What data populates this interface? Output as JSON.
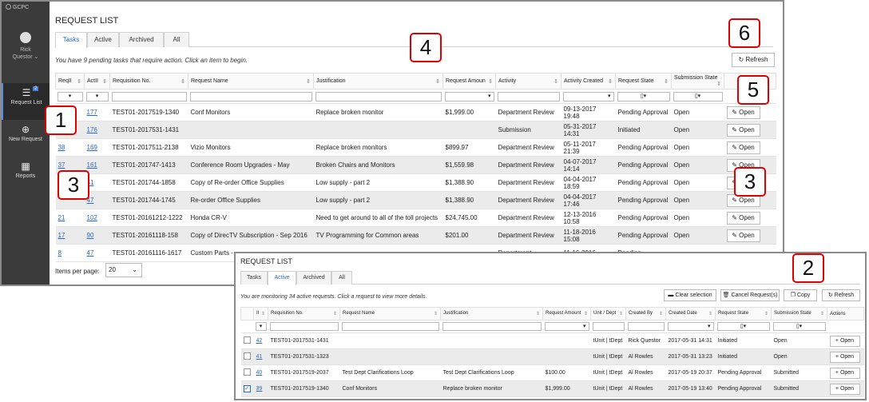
{
  "app": {
    "brand": "GCPC",
    "user_name": "Rick",
    "user_last": "Questor ⌄",
    "nav": [
      {
        "label": "Request List",
        "icon": "list-icon",
        "badge": "2"
      },
      {
        "label": "New Request",
        "icon": "plus-circle-icon"
      },
      {
        "label": "Reports",
        "icon": "grid-icon"
      }
    ]
  },
  "list1": {
    "title": "REQUEST LIST",
    "tabs": [
      "Tasks",
      "Active",
      "Archived",
      "All"
    ],
    "active_tab": "Tasks",
    "message": "You have 9 pending tasks that require action. Click an item to begin.",
    "refresh_label": "Refresh",
    "columns": [
      "ReqII",
      "ActII",
      "Requisition No.",
      "Request Name",
      "Justification",
      "Request Amoun",
      "Activity",
      "Activity Created",
      "Request State",
      "Submission State"
    ],
    "filter_glyph": "▾",
    "state_filter_glyph": "▯▾",
    "open_label": "Open",
    "rows": [
      {
        "req": "",
        "act": "177",
        "reqno": "TEST01-2017519-1340",
        "name": "Conf Monitors",
        "just": "Replace broken monitor",
        "amount": "$1,999.00",
        "activity": "Department Review",
        "created": "09-13-2017 19:48",
        "state": "Pending Approval",
        "sub": "Open"
      },
      {
        "req": "",
        "act": "176",
        "reqno": "TEST01-2017531-1431",
        "name": "",
        "just": "",
        "amount": "",
        "activity": "Submission",
        "created": "05-31-2017 14:31",
        "state": "Initiated",
        "sub": "Open"
      },
      {
        "req": "38",
        "act": "169",
        "reqno": "TEST01-2017511-2138",
        "name": "Vizio Monitors",
        "just": "Replace broken monitors",
        "amount": "$899.97",
        "activity": "Department Review",
        "created": "05-11-2017 21:39",
        "state": "Pending Approval",
        "sub": "Open"
      },
      {
        "req": "37",
        "act": "161",
        "reqno": "TEST01-201747-1413",
        "name": "Conference Room Upgrades - May",
        "just": "Broken Chairs and Monitors",
        "amount": "$1,559.98",
        "activity": "Department Review",
        "created": "04-07-2017 14:14",
        "state": "Pending Approval",
        "sub": "Open"
      },
      {
        "req": "",
        "act": "51",
        "reqno": "TEST01-201744-1858",
        "name": "Copy of Re-order Office Supplies",
        "just": "Low supply - part 2",
        "amount": "$1,388.90",
        "activity": "Department Review",
        "created": "04-04-2017 18:59",
        "state": "Pending Approval",
        "sub": "Open"
      },
      {
        "req": "",
        "act": "47",
        "reqno": "TEST01-201744-1745",
        "name": "Re-order Office Supplies",
        "just": "Low supply - part 2",
        "amount": "$1,388.90",
        "activity": "Department Review",
        "created": "04-04-2017 17:46",
        "state": "Pending Approval",
        "sub": "Open"
      },
      {
        "req": "21",
        "act": "102",
        "reqno": "TEST01-20161212-1222",
        "name": "Honda CR-V",
        "just": "Need to get around to all of the toll projects",
        "amount": "$24,745.00",
        "activity": "Department Review",
        "created": "12-13-2016 10:58",
        "state": "Pending Approval",
        "sub": "Open"
      },
      {
        "req": "17",
        "act": "90",
        "reqno": "TEST01-20161118-158",
        "name": "Copy of DirecTV Subscription - Sep 2016",
        "just": "TV Programming for Common areas",
        "amount": "$201.00",
        "activity": "Department Review",
        "created": "11-18-2016 15:08",
        "state": "Pending Approval",
        "sub": "Open"
      },
      {
        "req": "8",
        "act": "47",
        "reqno": "TEST01-20161116-1617",
        "name": "Custom Parts -",
        "just": "",
        "amount": "",
        "activity": "Department",
        "created": "11-16-2016",
        "state": "Pending",
        "sub": ""
      }
    ],
    "items_per_page_label": "Items per page:",
    "items_per_page_value": "20"
  },
  "list2": {
    "title": "REQUEST LIST",
    "tabs": [
      "Tasks",
      "Active",
      "Archived",
      "All"
    ],
    "active_tab": "Active",
    "message": "You are monitoring 34 active requests. Click a request to view more details.",
    "buttons": {
      "clear": "Clear selection",
      "cancel": "Cancel Request(s)",
      "copy": "Copy",
      "refresh": "Refresh"
    },
    "columns": [
      "",
      "II",
      "Requisition No.",
      "Request Name",
      "Justification",
      "Request Amount",
      "Unit / Dept",
      "Created By",
      "Created Date",
      "Request State",
      "Submission State",
      "Actions"
    ],
    "open_label": "Open",
    "rows": [
      {
        "checked": false,
        "id": "42",
        "reqno": "TEST01-2017531-1431",
        "name": "",
        "just": "",
        "amount": "",
        "unit": "tUnit | tDept",
        "by": "Rick Questor",
        "date": "2017-05-31 14:31",
        "state": "Initiated",
        "sub": "Open"
      },
      {
        "checked": false,
        "id": "41",
        "reqno": "TEST01-2017531-1323",
        "name": "",
        "just": "",
        "amount": "",
        "unit": "tUnit | tDept",
        "by": "Al Rowles",
        "date": "2017-05-31 13:23",
        "state": "Initiated",
        "sub": "Open"
      },
      {
        "checked": false,
        "id": "40",
        "reqno": "TEST01-2017519-2037",
        "name": "Test Dept Clarifications Loop",
        "just": "Test Dept Clarifications Loop",
        "amount": "$100.00",
        "unit": "tUnit | tDept",
        "by": "Al Rowles",
        "date": "2017-05-19 20:37",
        "state": "Pending Approval",
        "sub": "Submitted"
      },
      {
        "checked": true,
        "id": "39",
        "reqno": "TEST01-2017519-1340",
        "name": "Conf Monitors",
        "just": "Replace broken monitor",
        "amount": "$1,999.00",
        "unit": "tUnit | tDept",
        "by": "Al Rowles",
        "date": "2017-05-19 13:40",
        "state": "Pending Approval",
        "sub": "Submitted"
      }
    ]
  },
  "callouts": [
    "1",
    "2",
    "3",
    "3",
    "4",
    "5",
    "6"
  ]
}
